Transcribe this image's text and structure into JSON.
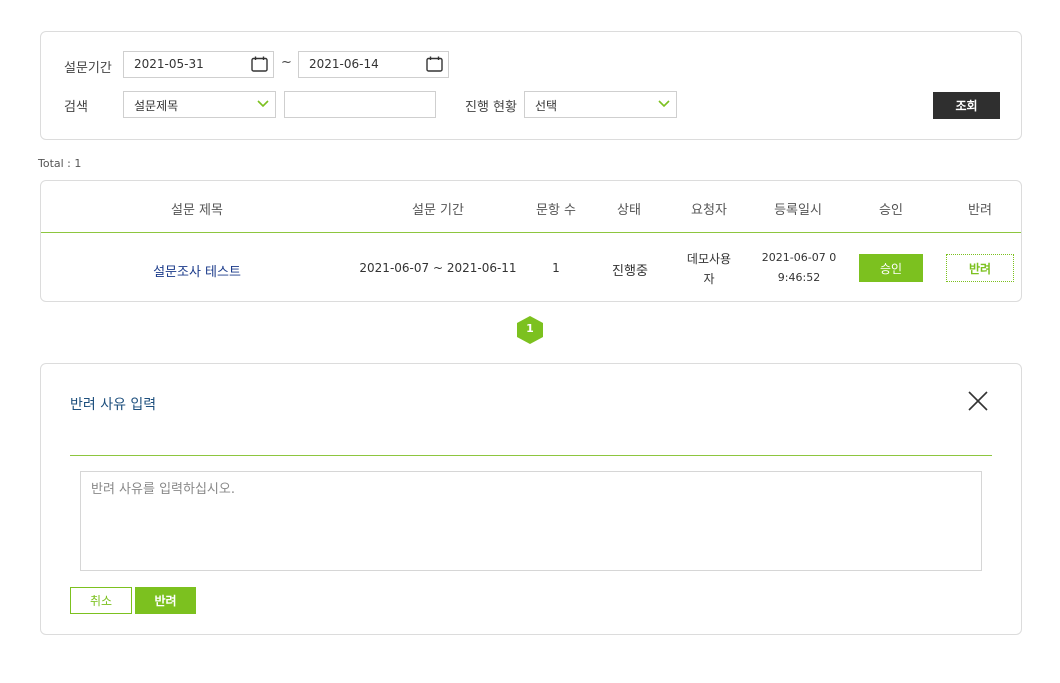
{
  "search": {
    "period_label": "설문기간",
    "start_date": "2021-05-31",
    "tilde": "~",
    "end_date": "2021-06-14",
    "search_label": "검색",
    "search_type": "설문제목",
    "keyword_value": "",
    "status_label": "진행 현황",
    "status_value": "선택",
    "query_label": "조회"
  },
  "total_text": "Total : 1",
  "table": {
    "headers": [
      "설문 제목",
      "설문 기간",
      "문항 수",
      "상태",
      "요청자",
      "등록일시",
      "승인",
      "반려"
    ],
    "rows": [
      {
        "title": "설문조사 테스트",
        "period": "2021-06-07 ~ 2021-06-11",
        "count": "1",
        "status": "진행중",
        "requester_line1": "데모사용",
        "requester_line2": "자",
        "registered_line1": "2021-06-07 0",
        "registered_line2": "9:46:52",
        "approve_label": "승인",
        "reject_label": "반려"
      }
    ]
  },
  "pagination": {
    "current": "1"
  },
  "reject_modal": {
    "title": "반려 사유 입력",
    "placeholder": "반려 사유를 입력하십시오.",
    "cancel_label": "취소",
    "reject_label": "반려"
  },
  "colors": {
    "accent": "#7cc11f",
    "dark_button": "#2f2f2f",
    "title_blue": "#1d4f7d"
  },
  "icons": {
    "date": "calendar-icon",
    "select": "chevron-down-icon",
    "close": "close-icon"
  }
}
